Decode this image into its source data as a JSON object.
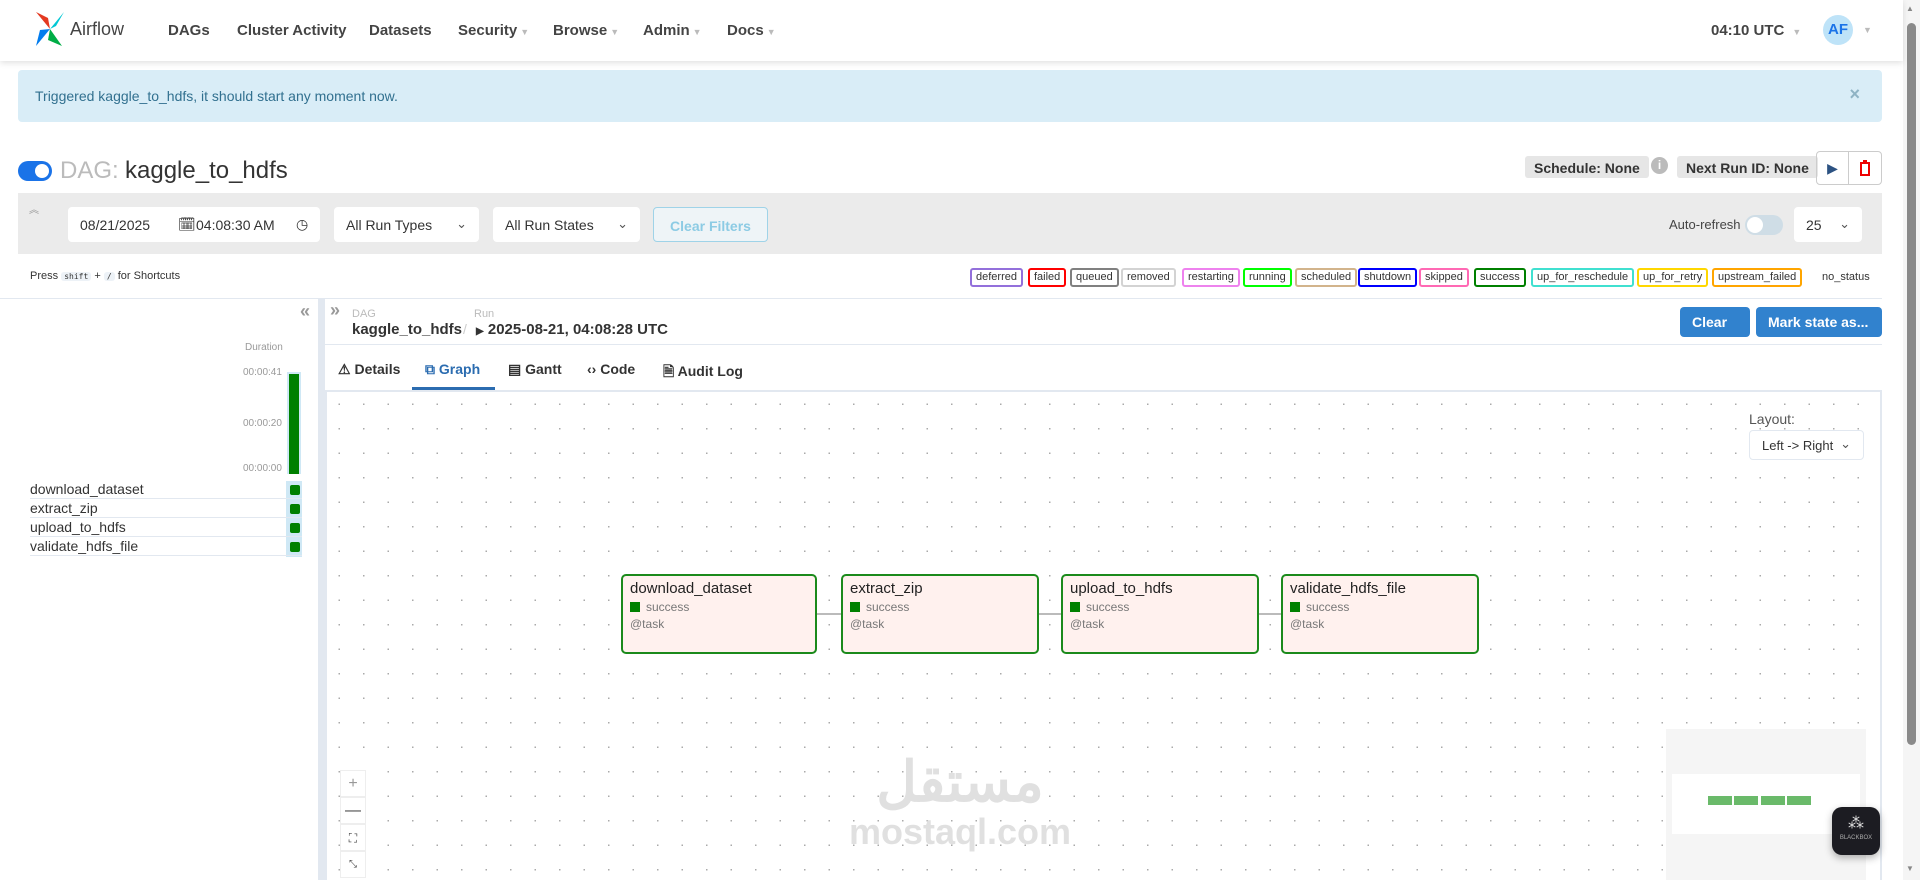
{
  "nav": {
    "brand": "Airflow",
    "items": [
      {
        "label": "DAGs"
      },
      {
        "label": "Cluster Activity"
      },
      {
        "label": "Datasets"
      },
      {
        "label": "Security",
        "dropdown": true
      },
      {
        "label": "Browse",
        "dropdown": true
      },
      {
        "label": "Admin",
        "dropdown": true
      },
      {
        "label": "Docs",
        "dropdown": true
      }
    ],
    "time": "04:10 UTC",
    "avatar": "AF"
  },
  "alert": {
    "message": "Triggered kaggle_to_hdfs, it should start any moment now.",
    "close": "×"
  },
  "dag": {
    "prefix": "DAG:",
    "name": "kaggle_to_hdfs",
    "schedule": "Schedule: None",
    "next_run": "Next Run ID: None",
    "paused": false
  },
  "filters": {
    "date": "08/21/2025",
    "time": "04:08:30 AM",
    "run_types": "All Run Types",
    "run_states": "All Run States",
    "clear": "Clear Filters",
    "auto_refresh": "Auto-refresh",
    "page_size": "25"
  },
  "shortcuts": {
    "press": "Press",
    "key1": "shift",
    "plus": "+",
    "key2": "/",
    "suffix": "for Shortcuts"
  },
  "legend": [
    {
      "label": "deferred",
      "color": "#9370db"
    },
    {
      "label": "failed",
      "color": "#ff0000"
    },
    {
      "label": "queued",
      "color": "#808080"
    },
    {
      "label": "removed",
      "color": "#d3d3d3"
    },
    {
      "label": "restarting",
      "color": "#ee82ee"
    },
    {
      "label": "running",
      "color": "#00ff00"
    },
    {
      "label": "scheduled",
      "color": "#d2b48c"
    },
    {
      "label": "shutdown",
      "color": "#0000ff"
    },
    {
      "label": "skipped",
      "color": "#ff69b4"
    },
    {
      "label": "success",
      "color": "#008000"
    },
    {
      "label": "up_for_reschedule",
      "color": "#40e0d0"
    },
    {
      "label": "up_for_retry",
      "color": "#ffd700"
    },
    {
      "label": "upstream_failed",
      "color": "#ffa500"
    },
    {
      "label": "no_status",
      "color": "#ffffff"
    }
  ],
  "grid": {
    "duration_label": "Duration",
    "ticks": [
      "00:00:41",
      "00:00:20",
      "00:00:00"
    ],
    "run_fraction": 1.0,
    "tasks": [
      "download_dataset",
      "extract_zip",
      "upload_to_hdfs",
      "validate_hdfs_file"
    ]
  },
  "breadcrumb": {
    "dag_label": "DAG",
    "dag": "kaggle_to_hdfs",
    "sep": "/",
    "run_label": "Run",
    "run": "2025-08-21, 04:08:28 UTC"
  },
  "actions": {
    "clear": "Clear",
    "mark": "Mark state as..."
  },
  "tabs": [
    {
      "label": "Details",
      "icon": "warning-icon"
    },
    {
      "label": "Graph",
      "icon": "graph-icon",
      "active": true
    },
    {
      "label": "Gantt",
      "icon": "gantt-icon"
    },
    {
      "label": "Code",
      "icon": "code-icon"
    },
    {
      "label": "Audit Log",
      "icon": "file-icon"
    }
  ],
  "graph": {
    "layout_label": "Layout:",
    "layout": "Left -> Right",
    "nodes": [
      {
        "name": "download_dataset",
        "state": "success",
        "op": "@task"
      },
      {
        "name": "extract_zip",
        "state": "success",
        "op": "@task"
      },
      {
        "name": "upload_to_hdfs",
        "state": "success",
        "op": "@task"
      },
      {
        "name": "validate_hdfs_file",
        "state": "success",
        "op": "@task"
      }
    ]
  },
  "watermark": {
    "arabic": "مستقل",
    "latin": "mostaql.com"
  },
  "blackbox": "BLACKBOX"
}
